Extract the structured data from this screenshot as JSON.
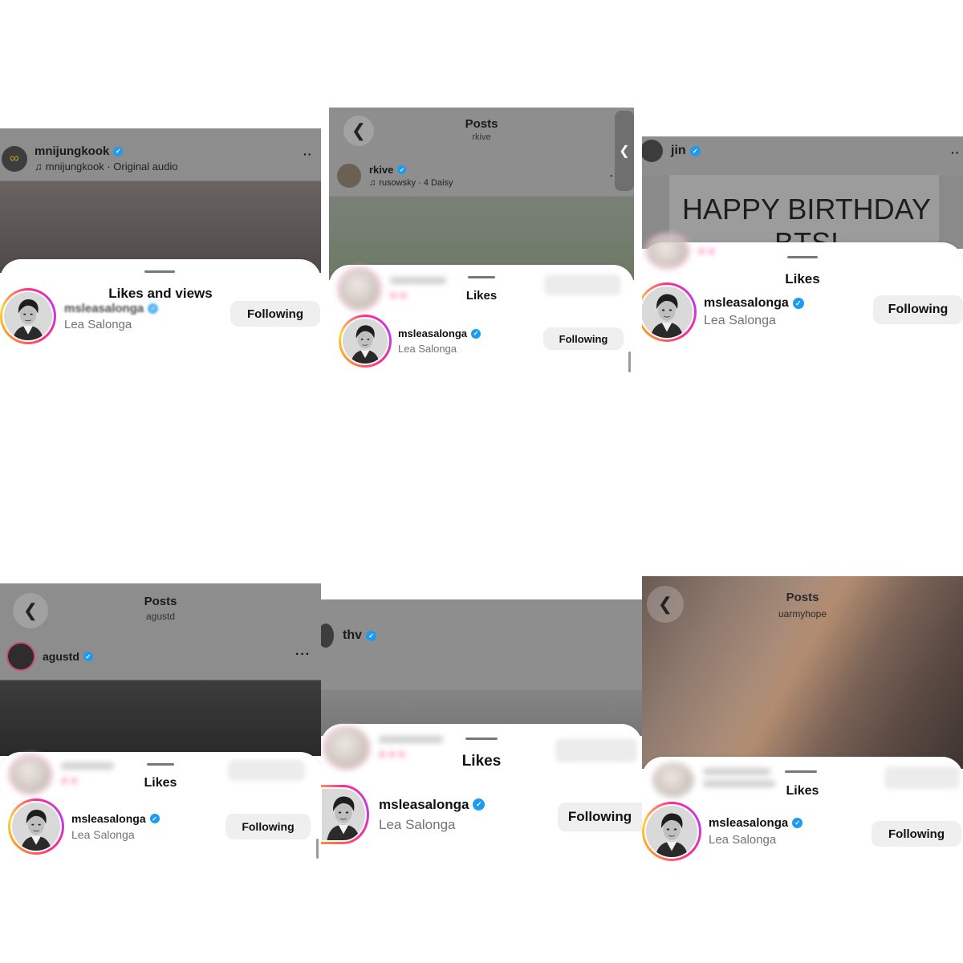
{
  "colors": {
    "verified": "#1d9bf0",
    "ring_start": "#ff2d8a",
    "ring_end": "#ffd43b",
    "button_bg": "#efefef"
  },
  "icons": {
    "back": "chevron-left-icon",
    "verified": "verified-badge-icon",
    "music": "music-note-icon",
    "more": "more-options-icon"
  },
  "liker": {
    "username": "msleasalonga",
    "full_name": "Lea Salonga",
    "button": "Following"
  },
  "panels": [
    {
      "post_user": "mnijungkook",
      "audio": "mnijungkook · Original audio",
      "sheet_title": "Likes and views"
    },
    {
      "header_title": "Posts",
      "header_sub": "rkive",
      "post_user": "rkive",
      "audio": "rusowsky · 4 Daisy",
      "sheet_title": "Likes"
    },
    {
      "post_user": "jin",
      "post_text": "HAPPY BIRTHDAY\nBTS!",
      "sheet_title": "Likes"
    },
    {
      "header_title": "Posts",
      "header_sub": "agustd",
      "post_user": "agustd",
      "sheet_title": "Likes"
    },
    {
      "post_user": "thv",
      "sheet_title": "Likes"
    },
    {
      "header_title": "Posts",
      "header_sub": "uarmyhope",
      "sheet_title": "Likes"
    }
  ]
}
